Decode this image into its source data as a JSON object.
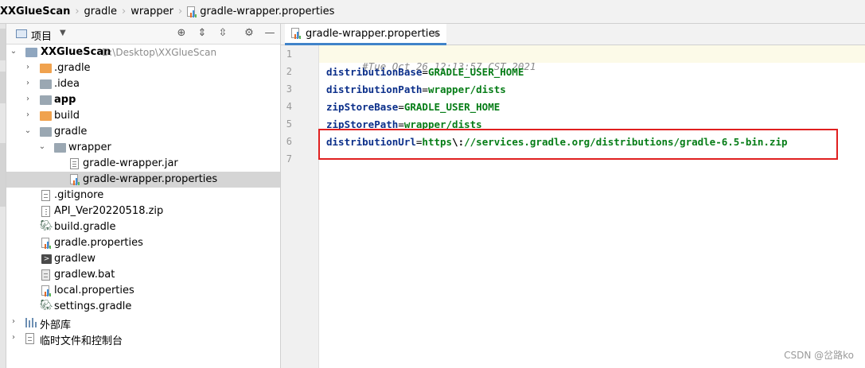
{
  "breadcrumb": {
    "items": [
      "XXGlueScan",
      "gradle",
      "wrapper",
      "gradle-wrapper.properties"
    ]
  },
  "project_panel": {
    "title": "项目",
    "tree": [
      {
        "label": "XXGlueScan",
        "path": "D:\\Desktop\\XXGlueScan",
        "icon": "module-folder-icon"
      },
      {
        "label": ".gradle",
        "icon": "folder-orange-icon"
      },
      {
        "label": ".idea",
        "icon": "folder-icon"
      },
      {
        "label": "app",
        "icon": "folder-module-icon"
      },
      {
        "label": "build",
        "icon": "folder-orange-icon"
      },
      {
        "label": "gradle",
        "icon": "folder-icon"
      },
      {
        "label": "wrapper",
        "icon": "folder-icon"
      },
      {
        "label": "gradle-wrapper.jar",
        "icon": "jar-file-icon"
      },
      {
        "label": "gradle-wrapper.properties",
        "icon": "properties-file-icon"
      },
      {
        "label": ".gitignore",
        "icon": "gitignore-file-icon"
      },
      {
        "label": "API_Ver20220518.zip",
        "icon": "zip-file-icon"
      },
      {
        "label": "build.gradle",
        "icon": "gradle-elephant-icon"
      },
      {
        "label": "gradle.properties",
        "icon": "properties-file-icon"
      },
      {
        "label": "gradlew",
        "icon": "terminal-file-icon"
      },
      {
        "label": "gradlew.bat",
        "icon": "bat-file-icon"
      },
      {
        "label": "local.properties",
        "icon": "properties-file-icon"
      },
      {
        "label": "settings.gradle",
        "icon": "gradle-elephant-icon"
      },
      {
        "label": "外部库",
        "icon": "library-icon"
      },
      {
        "label": "临时文件和控制台",
        "icon": "scratches-icon"
      }
    ]
  },
  "editor": {
    "tab_label": "gradle-wrapper.properties",
    "line_numbers": [
      "1",
      "2",
      "3",
      "4",
      "5",
      "6",
      "7"
    ],
    "lines": [
      {
        "comment": "#Tue Oct 26 12:13:57 CST 2021"
      },
      {
        "key": "distributionBase",
        "eq": "=",
        "value": "GRADLE_USER_HOME"
      },
      {
        "key": "distributionPath",
        "eq": "=",
        "value": "wrapper/dists"
      },
      {
        "key": "zipStoreBase",
        "eq": "=",
        "value": "GRADLE_USER_HOME"
      },
      {
        "key": "zipStorePath",
        "eq": "=",
        "value": "wrapper/dists"
      },
      {
        "key": "distributionUrl",
        "eq": "=",
        "value_a": "https",
        "esc": "\\:",
        "value_b": "//services.gradle.org/distributions/gradle-6.5-bin.zip"
      }
    ]
  },
  "watermark": "CSDN @岔路ko",
  "colors": {
    "accent": "#4083c9",
    "highlight_box": "#e02020",
    "key": "#0b2f8a",
    "value": "#067d17",
    "comment": "#8c8c8c"
  }
}
